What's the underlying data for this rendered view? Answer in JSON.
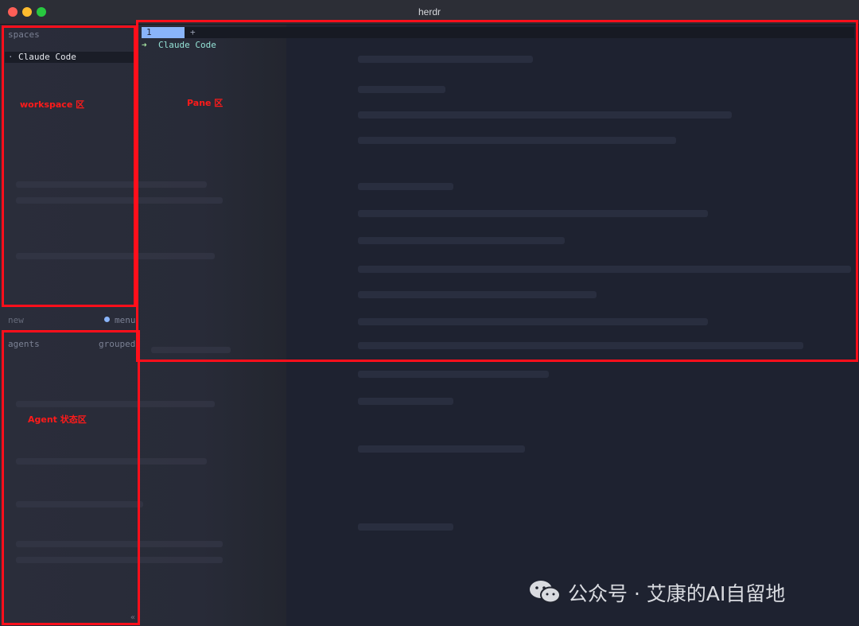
{
  "window": {
    "title": "herdr"
  },
  "sidebar": {
    "spaces_header": "spaces",
    "space_items": [
      {
        "bullet": "·",
        "label": "Claude Code"
      }
    ],
    "new_label": "new",
    "menu_label": "menu",
    "agents_header": "agents",
    "agents_mode": "grouped",
    "collapse_glyph": "«"
  },
  "pane": {
    "tabs": [
      {
        "label": "1"
      }
    ],
    "add_tab": "+",
    "prompt_arrow": "➜",
    "prompt_text": "Claude Code"
  },
  "annotations": {
    "workspace": "workspace 区",
    "pane": "Pane 区",
    "agent": "Agent 状态区"
  },
  "watermark": {
    "text": "公众号 · 艾康的AI自留地"
  },
  "colors": {
    "annotation": "#ff0f1b",
    "accent": "#89b4fa",
    "prompt_green": "#a6e3a1",
    "prompt_cyan": "#94e2d5"
  }
}
